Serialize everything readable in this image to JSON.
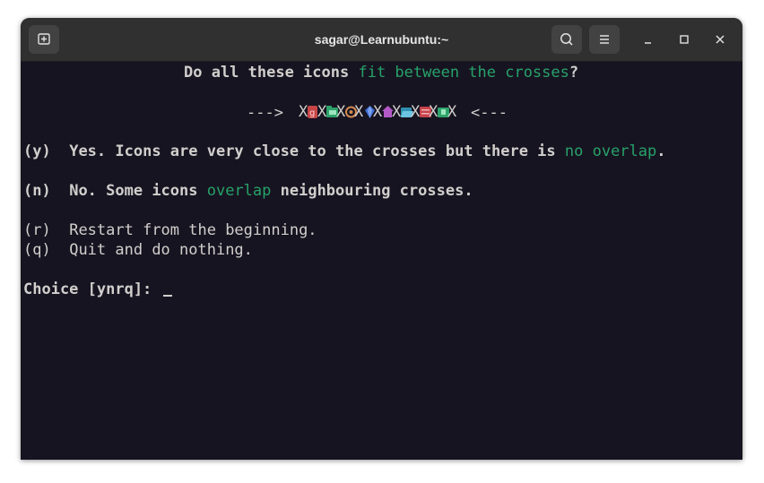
{
  "window": {
    "title": "sagar@Learnubuntu:~"
  },
  "icons": {
    "new_tab": "new-tab-icon",
    "search": "search-icon",
    "menu": "hamburger-menu-icon",
    "minimize": "minimize-icon",
    "maximize": "maximize-icon",
    "close": "close-icon"
  },
  "terminal": {
    "q_part1": "Do all these icons ",
    "q_part2": "fit between the crosses",
    "q_part3": "?",
    "arrow_left": "--->",
    "cross": "X",
    "arrow_right": "<---",
    "y_key": "(y)",
    "y_text1": "Yes. Icons are very close to the crosses but there is ",
    "y_text2": "no overlap",
    "y_text3": ".",
    "n_key": "(n)",
    "n_text1": "No. Some icons ",
    "n_text2": "overlap",
    "n_text3": " neighbouring crosses.",
    "r_key": "(r)",
    "r_text": "Restart from the beginning.",
    "q_key": "(q)",
    "q_text": "Quit and do nothing.",
    "prompt": "Choice [ynrq]:"
  },
  "colors": {
    "terminal_bg": "#171421",
    "titlebar_bg": "#303030",
    "text": "#d0cfcc",
    "highlight_green": "#26a269"
  }
}
